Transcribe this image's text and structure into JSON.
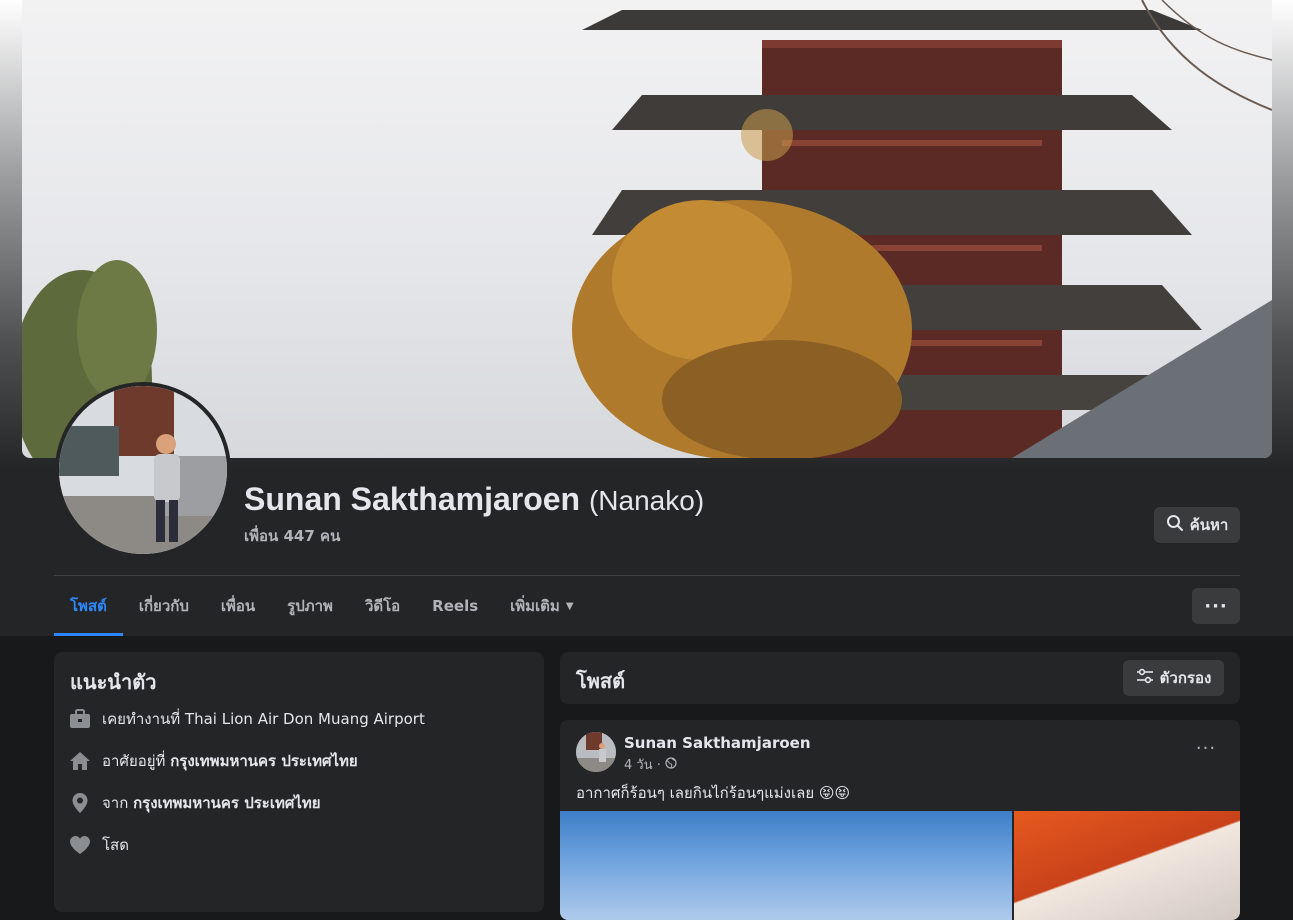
{
  "profile": {
    "name": "Sunan Sakthamjaroen",
    "alternate_name": "(Nanako)",
    "friends_count": "เพื่อน 447 คน"
  },
  "actions": {
    "search_label": "ค้นหา",
    "more_label": "···"
  },
  "tabs": [
    {
      "label": "โพสต์",
      "active": true
    },
    {
      "label": "เกี่ยวกับ",
      "active": false
    },
    {
      "label": "เพื่อน",
      "active": false
    },
    {
      "label": "รูปภาพ",
      "active": false
    },
    {
      "label": "วิดีโอ",
      "active": false
    },
    {
      "label": "Reels",
      "active": false
    },
    {
      "label": "เพิ่มเติม",
      "active": false
    }
  ],
  "intro": {
    "title": "แนะนำตัว",
    "work_prefix": "เคยทำงานที่ ",
    "work_value": "Thai Lion Air Don Muang Airport",
    "lives_prefix": "อาศัยอยู่ที่ ",
    "lives_value": "กรุงเทพมหานคร ประเทศไทย",
    "from_prefix": "จาก ",
    "from_value": "กรุงเทพมหานคร ประเทศไทย",
    "relationship": "โสด"
  },
  "posts_section": {
    "title": "โพสต์",
    "filter_label": "ตัวกรอง"
  },
  "post": {
    "author": "Sunan Sakthamjaroen",
    "time": "4 วัน ·",
    "text": "อากาศก็ร้อนๆ เลยกินไก่ร้อนๆแม่งเลย 😝😝",
    "menu_label": "···"
  },
  "colors": {
    "accent": "#2d88ff",
    "card_bg": "#242526",
    "page_bg": "#18191a"
  }
}
